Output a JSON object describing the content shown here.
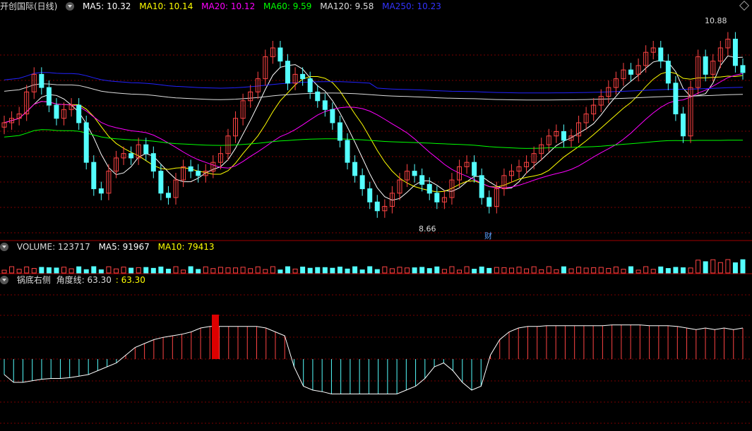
{
  "title": "开创国际(日线)",
  "ma_legend": [
    {
      "label": "MA5: 10.32",
      "color": "#ffffff"
    },
    {
      "label": "MA10: 10.14",
      "color": "#ffff00"
    },
    {
      "label": "MA20: 10.12",
      "color": "#ff00ff"
    },
    {
      "label": "MA60: 9.59",
      "color": "#00ff00"
    },
    {
      "label": "MA120: 9.58",
      "color": "#dddddd"
    },
    {
      "label": "MA250: 10.23",
      "color": "#2222ff"
    }
  ],
  "high_label": "10.88",
  "low_label": "8.66",
  "event_marker": "财",
  "volume_legend": [
    {
      "label": "VOLUME: 123717",
      "color": "#dddddd"
    },
    {
      "label": "MA5: 91967",
      "color": "#ffffff"
    },
    {
      "label": "MA10: 79413",
      "color": "#ffff00"
    }
  ],
  "indicator_legend": [
    {
      "label": "锅底右侧",
      "color": "#dddddd"
    },
    {
      "label": "角度线: 63.30",
      "color": "#dddddd"
    },
    {
      "label": ": 63.30",
      "color": "#ffff00"
    }
  ],
  "colors": {
    "up": "#ff4444",
    "down": "#54ffff",
    "grid": "#7a0000"
  },
  "chart_data": {
    "type": "candlestick",
    "price_range": [
      8.5,
      11.0
    ],
    "candles_close": [
      9.75,
      9.8,
      9.85,
      10.1,
      10.3,
      10.15,
      9.95,
      9.8,
      9.9,
      9.95,
      9.75,
      9.3,
      9.0,
      8.95,
      9.2,
      9.35,
      9.4,
      9.35,
      9.5,
      9.4,
      9.2,
      8.95,
      8.9,
      9.1,
      9.25,
      9.2,
      9.15,
      9.2,
      9.3,
      9.4,
      9.6,
      9.8,
      10.0,
      10.1,
      10.25,
      10.5,
      10.6,
      10.45,
      10.2,
      10.3,
      10.25,
      10.1,
      10.0,
      9.9,
      9.75,
      9.55,
      9.3,
      9.15,
      9.0,
      8.85,
      8.75,
      8.8,
      8.95,
      9.1,
      9.2,
      9.15,
      9.05,
      8.95,
      8.85,
      8.9,
      9.1,
      9.25,
      9.3,
      9.15,
      8.9,
      8.8,
      9.0,
      9.15,
      9.2,
      9.25,
      9.3,
      9.4,
      9.5,
      9.6,
      9.65,
      9.55,
      9.6,
      9.75,
      9.85,
      9.95,
      10.05,
      10.15,
      10.25,
      10.35,
      10.3,
      10.4,
      10.55,
      10.6,
      10.45,
      10.2,
      9.85,
      9.6,
      10.15,
      10.5,
      10.3,
      10.45,
      10.6,
      10.7,
      10.4,
      10.32
    ],
    "angle_line": [
      -20,
      -30,
      -30,
      -28,
      -26,
      -25,
      -25,
      -24,
      -22,
      -20,
      -15,
      -10,
      -5,
      5,
      15,
      20,
      25,
      28,
      30,
      32,
      35,
      40,
      42,
      42,
      42,
      42,
      42,
      42,
      40,
      35,
      30,
      -10,
      -35,
      -40,
      -42,
      -45,
      -45,
      -45,
      -45,
      -45,
      -45,
      -45,
      -45,
      -40,
      -35,
      -25,
      -10,
      -5,
      -15,
      -30,
      -40,
      -35,
      5,
      25,
      35,
      40,
      42,
      42,
      43,
      43,
      43,
      43,
      43,
      43,
      43,
      44,
      44,
      44,
      44,
      43,
      43,
      43,
      42,
      40,
      38,
      40,
      38,
      40,
      38,
      40
    ],
    "volume_range": [
      0,
      150000
    ]
  }
}
